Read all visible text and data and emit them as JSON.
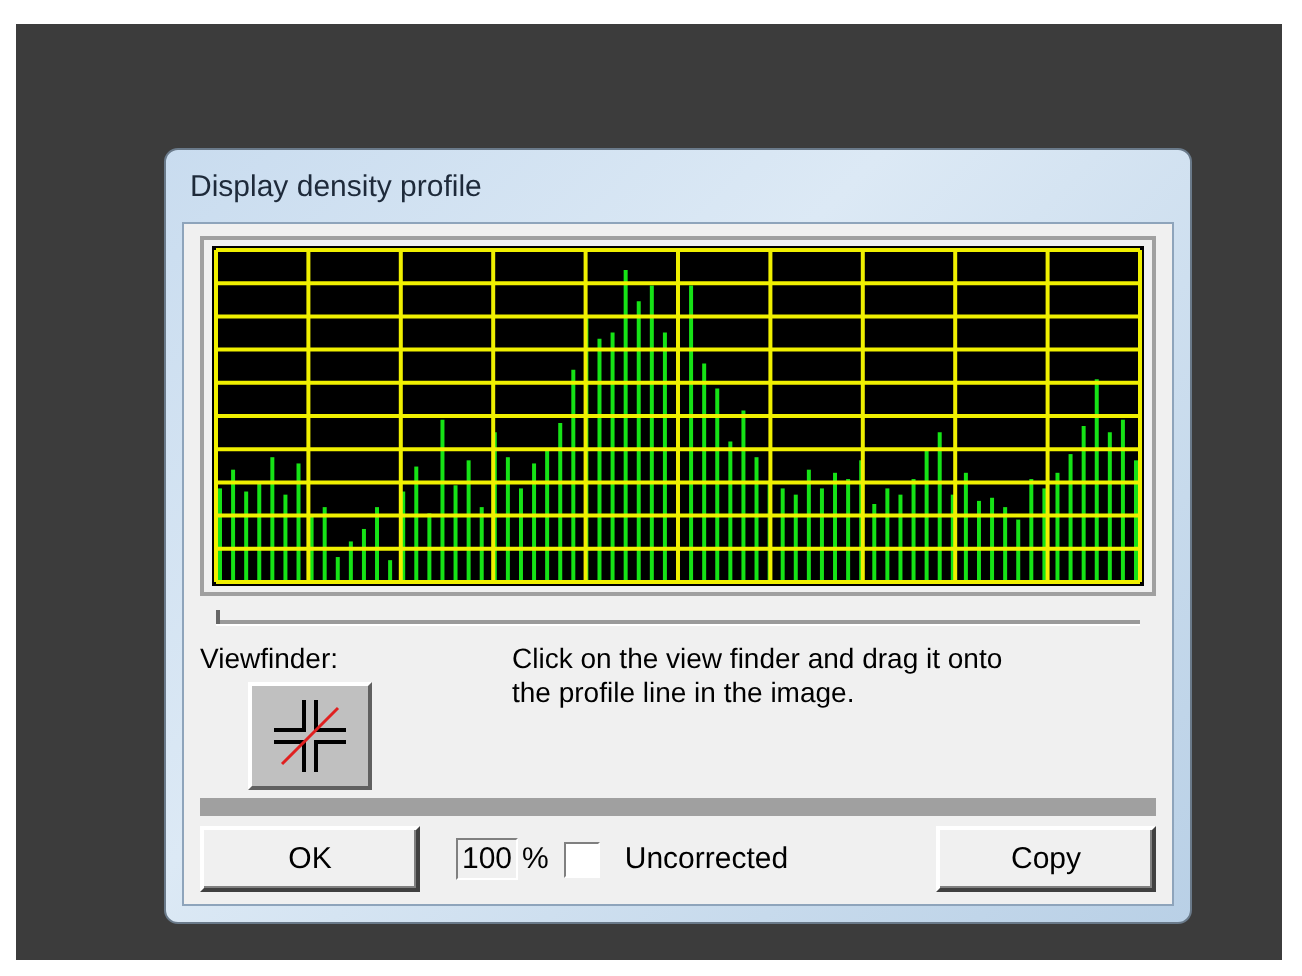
{
  "window": {
    "title": "Display density profile"
  },
  "profile_slider": {
    "level": 0
  },
  "viewfinder": {
    "label": "Viewfinder:"
  },
  "instructions": "Click on the view finder and drag it onto the profile line in the image.",
  "footer": {
    "ok": "OK",
    "zoom_value": "100",
    "zoom_unit": "%",
    "uncorrected": {
      "label": "Uncorrected",
      "checked": false
    },
    "copy": "Copy"
  }
}
